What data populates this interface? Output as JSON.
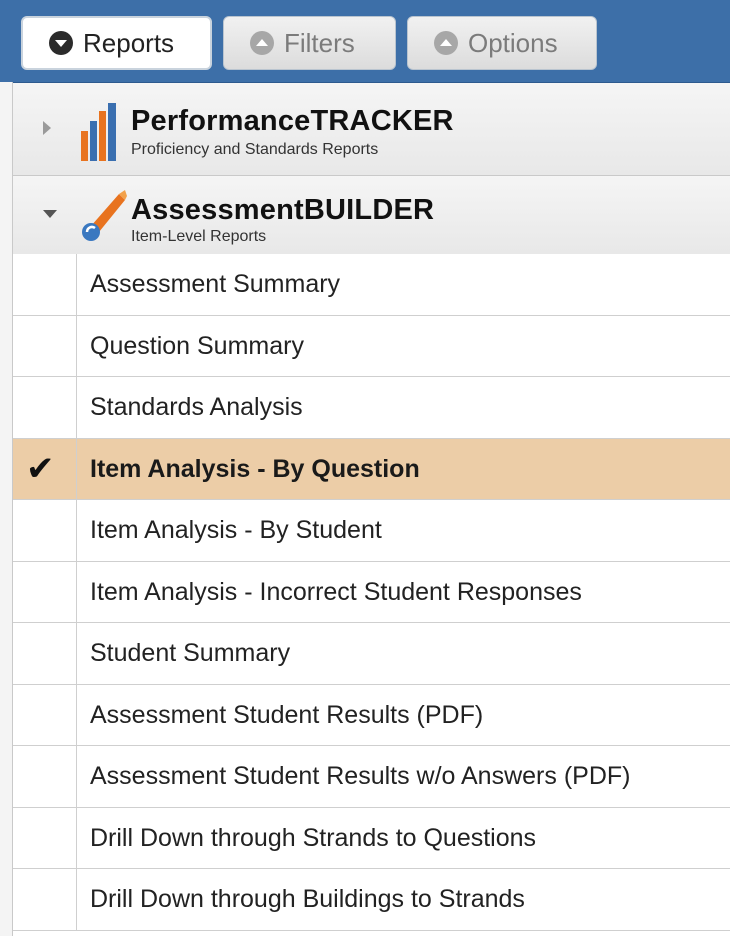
{
  "tabs": [
    {
      "label": "Reports",
      "icon": "chevron-down-circle-icon",
      "active": true
    },
    {
      "label": "Filters",
      "icon": "chevron-up-circle-icon",
      "active": false
    },
    {
      "label": "Options",
      "icon": "chevron-up-circle-icon",
      "active": false
    }
  ],
  "sections": [
    {
      "title": "PerformanceTRACKER",
      "subtitle": "Proficiency and Standards Reports",
      "expanded": false,
      "icon": "bar-chart-icon"
    },
    {
      "title": "AssessmentBUILDER",
      "subtitle": "Item-Level Reports",
      "expanded": true,
      "icon": "paintbrush-icon"
    }
  ],
  "reports": [
    {
      "label": "Assessment Summary",
      "selected": false
    },
    {
      "label": "Question Summary",
      "selected": false
    },
    {
      "label": "Standards Analysis",
      "selected": false
    },
    {
      "label": "Item Analysis - By Question",
      "selected": true
    },
    {
      "label": "Item Analysis - By Student",
      "selected": false
    },
    {
      "label": "Item Analysis - Incorrect Student Responses",
      "selected": false
    },
    {
      "label": "Student Summary",
      "selected": false
    },
    {
      "label": "Assessment Student Results (PDF)",
      "selected": false
    },
    {
      "label": "Assessment Student Results w/o Answers (PDF)",
      "selected": false
    },
    {
      "label": "Drill Down through Strands to Questions",
      "selected": false
    },
    {
      "label": "Drill Down through Buildings to Strands",
      "selected": false
    }
  ],
  "checkmark_glyph": "✔",
  "colors": {
    "header_blue": "#3d6fa8",
    "selected_row": "#eccda7",
    "bar_chart_blue": "#3a6fb0",
    "bar_chart_orange": "#e8731f",
    "brush_orange": "#e8731f",
    "brush_blue": "#3a78c0"
  }
}
